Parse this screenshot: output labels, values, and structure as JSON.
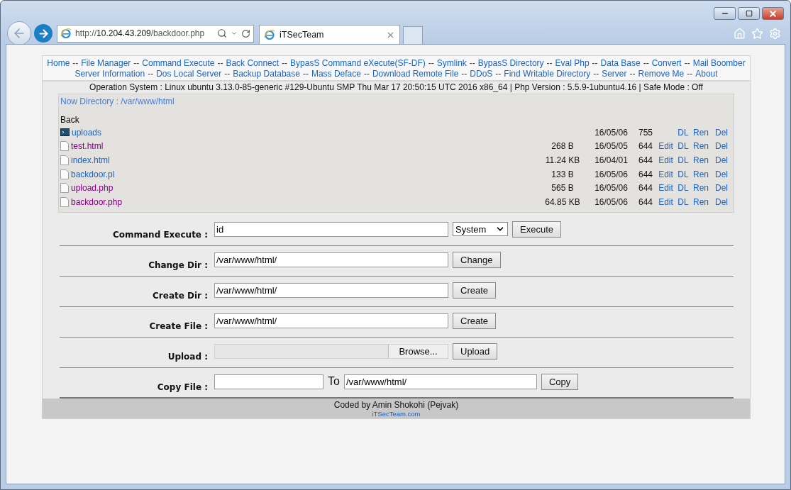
{
  "browser": {
    "address_url": "http://**10.204.43.209**/backdoor.php",
    "tab_title": "iTSecTeam"
  },
  "nav": [
    [
      {
        "label": "Home",
        "separator": "--"
      },
      {
        "label": "File Manager",
        "separator": "--"
      },
      {
        "label": "Command Execute",
        "separator": "--"
      },
      {
        "label": "Back Connect",
        "separator": "--"
      },
      {
        "label": "BypasS Command eXecute(SF-DF)",
        "separator": "--"
      },
      {
        "label": "Symlink",
        "separator": "--"
      },
      {
        "label": "BypasS Directory",
        "separator": "--"
      },
      {
        "label": "Eval Php",
        "separator": "--"
      },
      {
        "label": "Data Base",
        "separator": "--"
      },
      {
        "label": "Convert",
        "separator": "--"
      },
      {
        "label": "Mail Boomber"
      }
    ],
    [
      {
        "label": "Server Information",
        "separator": "--"
      },
      {
        "label": "Dos Local Server",
        "separator": "--"
      },
      {
        "label": "Backup Database",
        "separator": "--"
      },
      {
        "label": "Mass Deface",
        "separator": "--"
      },
      {
        "label": "Download Remote File",
        "separator": "--"
      },
      {
        "label": "DDoS",
        "separator": "--"
      },
      {
        "label": "Find Writable Directory",
        "separator": "--"
      },
      {
        "label": "Server",
        "separator": "--"
      },
      {
        "label": "Remove Me",
        "separator": "--"
      },
      {
        "label": "About"
      }
    ]
  ],
  "system_info": "Operation System : Linux ubuntu 3.13.0-85-generic #129-Ubuntu SMP Thu Mar 17 20:50:15 UTC 2016 x86_64 | Php Version : 5.5.9-1ubuntu4.16 | Safe Mode : Off",
  "file_manager": {
    "current_directory": "Now Directory : /var/www/html",
    "back": "Back",
    "files": [
      {
        "kind": "folder",
        "name": "uploads",
        "visited": false,
        "date": "16/05/06",
        "perm": "755",
        "actions": [
          "DL",
          "Ren",
          "Del"
        ]
      },
      {
        "kind": "file",
        "name": "test.html",
        "visited": true,
        "size": "268 B",
        "date": "16/05/05",
        "perm": "644",
        "actions": [
          "Edit",
          "DL",
          "Ren",
          "Del"
        ]
      },
      {
        "kind": "file",
        "name": "index.html",
        "visited": false,
        "size": "11.24 KB",
        "date": "16/04/01",
        "perm": "644",
        "actions": [
          "Edit",
          "DL",
          "Ren",
          "Del"
        ]
      },
      {
        "kind": "file",
        "name": "backdoor.pl",
        "visited": false,
        "size": "133 B",
        "date": "16/05/06",
        "perm": "644",
        "actions": [
          "Edit",
          "DL",
          "Ren",
          "Del"
        ]
      },
      {
        "kind": "file",
        "name": "upload.php",
        "visited": true,
        "size": "565 B",
        "date": "16/05/06",
        "perm": "644",
        "actions": [
          "Edit",
          "DL",
          "Ren",
          "Del"
        ]
      },
      {
        "kind": "file",
        "name": "backdoor.php",
        "visited": true,
        "size": "64.85 KB",
        "date": "16/05/06",
        "perm": "644",
        "actions": [
          "Edit",
          "DL",
          "Ren",
          "Del"
        ]
      }
    ]
  },
  "forms": [
    {
      "kind": "command",
      "label": "Command Execute :",
      "value": "id",
      "select": "System",
      "button": "Execute"
    },
    {
      "kind": "text",
      "label": "Change Dir :",
      "value": "/var/www/html/",
      "button": "Change"
    },
    {
      "kind": "text",
      "label": "Create Dir :",
      "value": "/var/www/html/",
      "button": "Create"
    },
    {
      "kind": "text",
      "label": "Create File :",
      "value": "/var/www/html/",
      "button": "Create"
    },
    {
      "kind": "upload",
      "label": "Upload :",
      "browse": "Browse...",
      "button": "Upload"
    },
    {
      "kind": "copy",
      "label": "Copy File :",
      "joiner": "To",
      "value": "/var/www/html/",
      "button": "Copy"
    }
  ],
  "footer": {
    "credit": "Coded by Amin Shokohi (Pejvak)",
    "link": "iTSecTeam.com"
  }
}
